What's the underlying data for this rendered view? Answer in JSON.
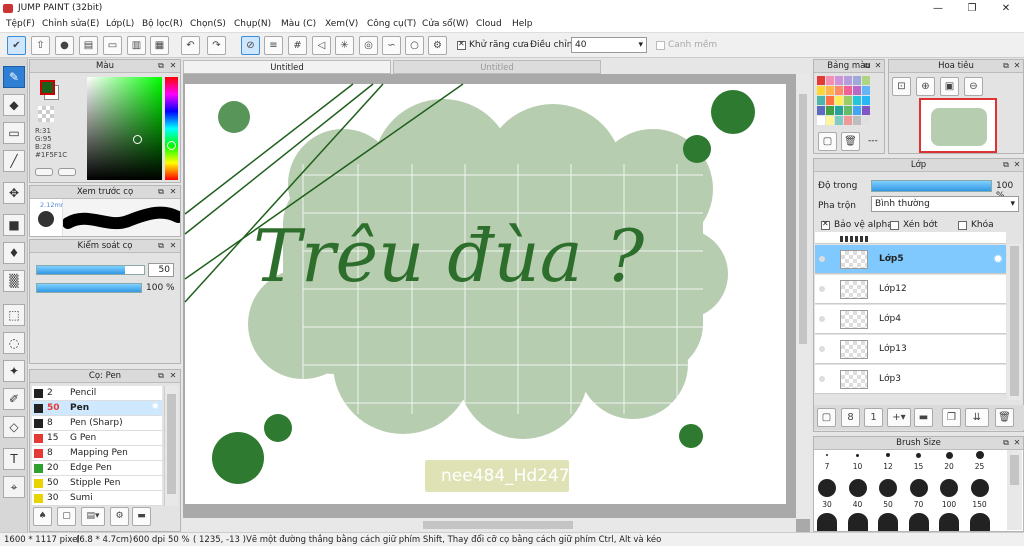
{
  "window": {
    "title": "JUMP PAINT (32bit)",
    "minimize": "—",
    "maximize": "❐",
    "close": "✕"
  },
  "menu": [
    "Tệp(F)",
    "Chỉnh sửa(E)",
    "Lớp(L)",
    "Bộ lọc(R)",
    "Chọn(S)",
    "Chụp(N)",
    "Màu (C)",
    "Xem(V)",
    "Công cụ(T)",
    "Cửa sổ(W)",
    "Cloud",
    "Help"
  ],
  "toolbar": {
    "antialias_label": "Khử răng cưa",
    "adjust_label": "Điều chỉnh",
    "adjust_value": "40",
    "snap_label": "Canh mềm",
    "antialias_checked": true
  },
  "color_panel": {
    "title": "Màu",
    "r": "R:31",
    "g": "G:95",
    "b": "B:28",
    "hex": "#1F5F1C",
    "fg": "#1f5f1c",
    "bg": "#ffffff"
  },
  "preview_panel": {
    "title": "Xem trước cọ",
    "size": "2.12mm"
  },
  "brush_control": {
    "title": "Kiểm soát cọ",
    "size": "50",
    "opacity": "100 %",
    "size_fraction": 0.82,
    "opacity_fraction": 1.0
  },
  "brush_list": {
    "title": "Cọ: Pen",
    "items": [
      {
        "size": "2",
        "name": "Pencil",
        "color": "#222222"
      },
      {
        "size": "50",
        "name": "Pen",
        "color": "#222222",
        "selected": true
      },
      {
        "size": "8",
        "name": "Pen (Sharp)",
        "color": "#222222"
      },
      {
        "size": "15",
        "name": "G Pen",
        "color": "#e53935"
      },
      {
        "size": "8",
        "name": "Mapping Pen",
        "color": "#e53935"
      },
      {
        "size": "20",
        "name": "Edge Pen",
        "color": "#2ea02e"
      },
      {
        "size": "50",
        "name": "Stipple Pen",
        "color": "#e8d400"
      },
      {
        "size": "30",
        "name": "Sumi",
        "color": "#e8d400"
      }
    ]
  },
  "tabs": {
    "active": "Untitled",
    "inactive": "Untitled"
  },
  "canvas": {
    "text": "Trêu đùa ?",
    "watermark": "nee484_Hd247"
  },
  "palette_panel": {
    "title": "Bảng màu",
    "colors": [
      "#e53935",
      "#f48fb1",
      "#ce93d8",
      "#b39ddb",
      "#9fa8da",
      "#aed581",
      "#fdd835",
      "#ffb74d",
      "#ff8a65",
      "#f06292",
      "#ba68c8",
      "#64b5f6",
      "#4db6ac",
      "#ff7043",
      "#ffee58",
      "#9ccc65",
      "#26c6da",
      "#29b6f6",
      "#5c6bc0",
      "#43a047",
      "#26a69a",
      "#66bb6a",
      "#42a5f5",
      "#7e57c2",
      "#ffffff",
      "#fff59d",
      "#80cbc4",
      "#ef9a9a",
      "#bdbdbd",
      "#e0e0e0"
    ]
  },
  "navigator": {
    "title": "Hoa tiêu"
  },
  "layer_panel": {
    "title": "Lớp",
    "opacity_label": "Độ trong",
    "opacity": "100 %",
    "blend_label": "Pha trộn",
    "blend_value": "Bình thường",
    "protect_alpha": "Bảo vệ alpha",
    "clip": "Xén bớt",
    "lock": "Khóa",
    "layers": [
      {
        "name": "Lớp5",
        "selected": true
      },
      {
        "name": "Lớp12"
      },
      {
        "name": "Lớp4"
      },
      {
        "name": "Lớp13"
      },
      {
        "name": "Lớp3"
      }
    ]
  },
  "brush_size_panel": {
    "title": "Brush Size",
    "row1": [
      "7",
      "10",
      "12",
      "15",
      "20",
      "25"
    ],
    "row2": [
      "30",
      "40",
      "50",
      "70",
      "100",
      "150"
    ]
  },
  "status": {
    "dims": "1600 * 1117 pixel",
    "mm": "(6.8 * 4.7cm)",
    "dpi": "600 dpi",
    "zoom": "50 %",
    "coords": "( 1235, -13 )",
    "hint": "Vẽ một đường thẳng bằng cách giữ phím Shift, Thay đổi cỡ cọ bằng cách giữ phím Ctrl, Alt và kéo"
  }
}
